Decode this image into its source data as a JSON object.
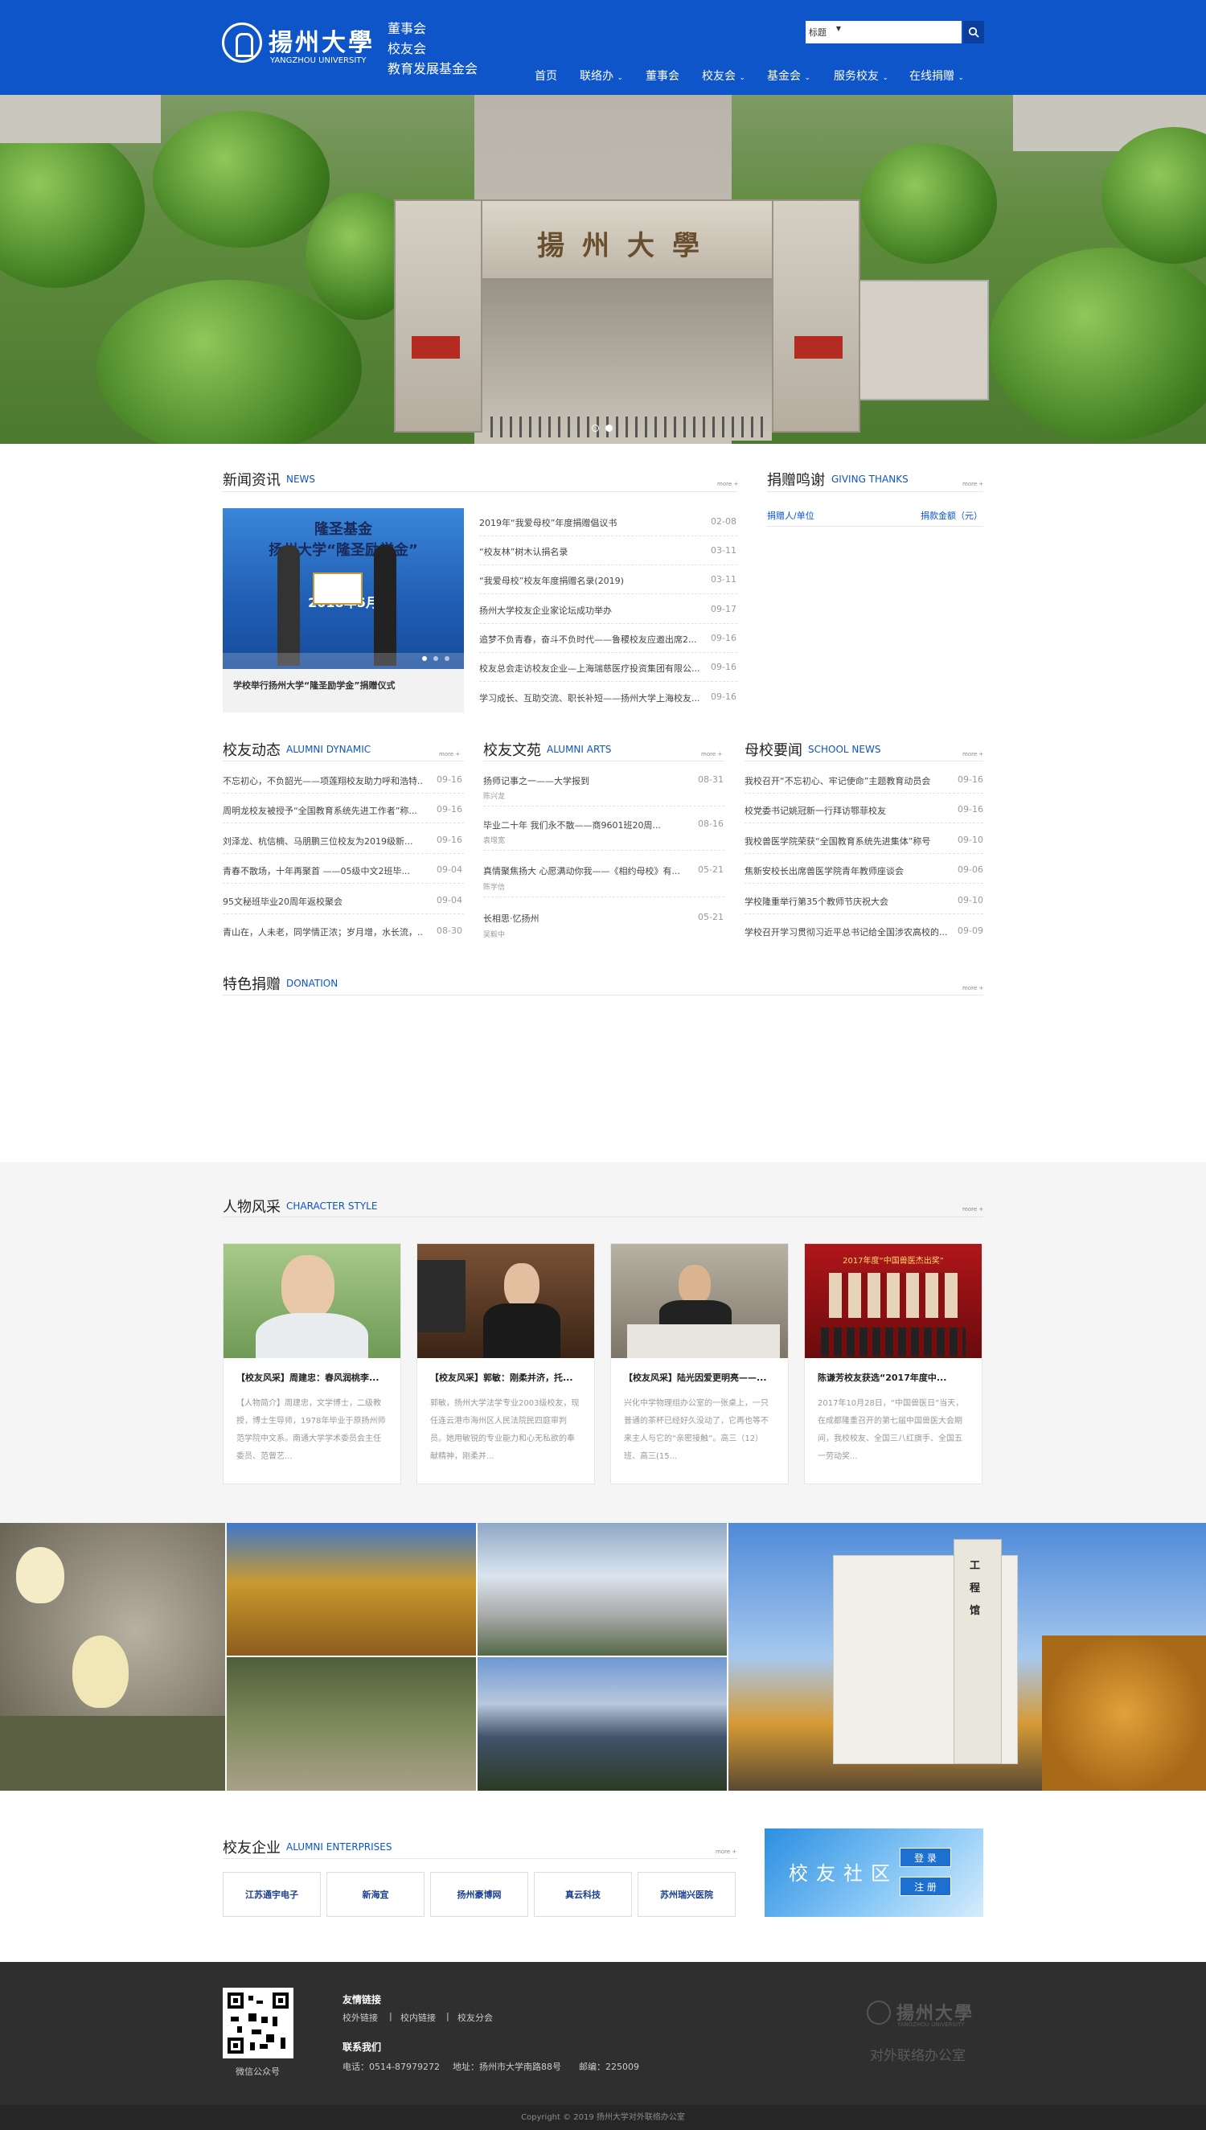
{
  "header": {
    "logo_cn": "揚州大學",
    "logo_en": "YANGZHOU UNIVERSITY",
    "org_lines": [
      "董事会",
      "校友会",
      "教育发展基金会"
    ],
    "search_select": "标题",
    "search_placeholder": "",
    "nav": [
      "首页",
      "联络办",
      "董事会",
      "校友会",
      "基金会",
      "服务校友",
      "在线捐赠"
    ]
  },
  "hero": {
    "gate_text": "揚州大學",
    "slides_total": 2,
    "active_slide": 2
  },
  "news": {
    "title": "新闻资讯",
    "subtitle": "NEWS",
    "more": "more +",
    "featured_caption": "学校举行扬州大学“隆圣励学金”捐赠仪式",
    "featured_banner": "隆圣基金",
    "featured_banner2": "扬州大学“隆圣励学金”",
    "featured_date_text": "2018年5月",
    "items": [
      {
        "title": "2019年“我爱母校”年度捐赠倡议书",
        "date": "02-08"
      },
      {
        "title": "“校友林”树木认捐名录",
        "date": "03-11"
      },
      {
        "title": "“我爱母校”校友年度捐赠名录(2019)",
        "date": "03-11"
      },
      {
        "title": "扬州大学校友企业家论坛成功举办",
        "date": "09-17"
      },
      {
        "title": "追梦不负青春，奋斗不负时代——鲁稷校友应邀出席2...",
        "date": "09-16"
      },
      {
        "title": "校友总会走访校友企业—上海瑞慈医疗投资集团有限公...",
        "date": "09-16"
      },
      {
        "title": "学习成长、互助交流、职长补短——扬州大学上海校友...",
        "date": "09-16"
      }
    ]
  },
  "thanks": {
    "title": "捐赠鸣谢",
    "subtitle": "GIVING THANKS",
    "more": "more +",
    "col1": "捐赠人/单位",
    "col2": "捐款金额（元）"
  },
  "alumni_dynamic": {
    "title": "校友动态",
    "subtitle": "ALUMNI DYNAMIC",
    "more": "more +",
    "items": [
      {
        "title": "不忘初心，不负韶光——项莲翔校友助力呼和浩特...",
        "date": "09-16"
      },
      {
        "title": "周明龙校友被授予“全国教育系统先进工作者”称...",
        "date": "09-16"
      },
      {
        "title": "刘泽龙、杭信楠、马朋鹏三位校友为2019级新...",
        "date": "09-16"
      },
      {
        "title": "青春不散场，十年再聚首 ——05级中文2班毕...",
        "date": "09-04"
      },
      {
        "title": "95文秘班毕业20周年返校聚会",
        "date": "09-04"
      },
      {
        "title": "青山在，人未老，同学情正浓；岁月增，水长流，...",
        "date": "08-30"
      }
    ]
  },
  "alumni_arts": {
    "title": "校友文苑",
    "subtitle": "ALUMNI ARTS",
    "more": "more +",
    "items": [
      {
        "title": "扬师记事之一——大学报到",
        "author": "陈兴龙",
        "date": "08-31"
      },
      {
        "title": "毕业二十年 我们永不散——商9601班20周...",
        "author": "袁增宽",
        "date": "08-16"
      },
      {
        "title": "真情聚焦扬大 心愿满动你我——《相约母校》有...",
        "author": "陈学信",
        "date": "05-21"
      },
      {
        "title": "长相思·忆扬州",
        "author": "吴毅中",
        "date": "05-21"
      }
    ]
  },
  "school_news": {
    "title": "母校要闻",
    "subtitle": "SCHOOL NEWS",
    "more": "more +",
    "items": [
      {
        "title": "我校召开“不忘初心、牢记使命”主题教育动员会",
        "date": "09-16"
      },
      {
        "title": "校党委书记姚冠新一行拜访鄂菲校友",
        "date": "09-16"
      },
      {
        "title": "我校兽医学院荣获“全国教育系统先进集体”称号",
        "date": "09-10"
      },
      {
        "title": "焦新安校长出席兽医学院青年教师座谈会",
        "date": "09-06"
      },
      {
        "title": "学校隆重举行第35个教师节庆祝大会",
        "date": "09-10"
      },
      {
        "title": "学校召开学习贯彻习近平总书记给全国涉农高校的...",
        "date": "09-09"
      }
    ]
  },
  "donation": {
    "title": "特色捐赠",
    "subtitle": "DONATION",
    "more": "more +"
  },
  "people": {
    "title": "人物风采",
    "subtitle": "CHARACTER STYLE",
    "more": "more +",
    "cards": [
      {
        "title": "【校友风采】周建忠：春风润桃李...",
        "desc": "【人物简介】周建忠，文学博士，二级教授，博士生导师，1978年毕业于原扬州师范学院中文系。南通大学学术委员会主任委员、范曾艺..."
      },
      {
        "title": "【校友风采】郭敏：刚柔并济，托...",
        "desc": "郭敏，扬州大学法学专业2003级校友，现任连云港市海州区人民法院民四庭审判员。她用敏锐的专业能力和心无私欲的奉献精神，刚柔并..."
      },
      {
        "title": "【校友风采】陆光因爱更明亮——...",
        "desc": "兴化中学物理组办公室的一张桌上，一只普通的茶杯已经好久没动了，它再也等不来主人与它的“亲密接触”。高三（12）班、高三(15..."
      },
      {
        "title": "陈谦芳校友获选“2017年度中...",
        "desc": "2017年10月28日，“中国兽医日”当天，在成都隆重召开的第七届中国兽医大会期间，我校校友、全国三八红旗手、全国五一劳动奖..."
      }
    ],
    "card3_stage_text": "2017年度“中国兽医杰出奖”"
  },
  "gallery": {
    "building_sign": "工程馆"
  },
  "enterprises": {
    "title": "校友企业",
    "subtitle": "ALUMNI ENTERPRISES",
    "more": "more +",
    "logos": [
      "江苏通宇电子",
      "新海宜",
      "扬州豪博网",
      "真云科技",
      "苏州瑞兴医院"
    ]
  },
  "community": {
    "title": "校友社区",
    "login": "登 录",
    "register": "注 册"
  },
  "footer": {
    "qr_caption": "微信公众号",
    "links_title": "友情链接",
    "links": [
      "校外链接",
      "校内链接",
      "校友分会"
    ],
    "contact_title": "联系我们",
    "phone": "电话：0514-87979272",
    "address": "地址：扬州市大学南路88号",
    "postcode": "邮编：225009",
    "brand_cn": "揚州大學",
    "brand_en": "YANGZHOU UNIVERSITY",
    "office": "对外联络办公室",
    "copyright": "Copyright © 2019 扬州大学对外联络办公室"
  },
  "colors": {
    "primary": "#0d55c9",
    "footer": "#2f2f2f"
  }
}
